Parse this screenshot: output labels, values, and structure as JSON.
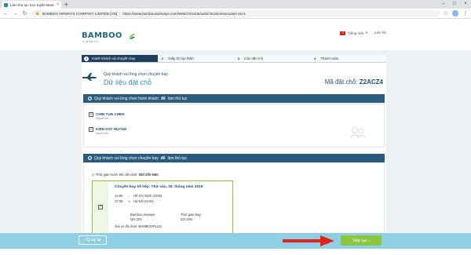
{
  "browser": {
    "tab_title": "Làm thủ tục trực tuyến Bamboo ...",
    "tab_close": "×",
    "new_tab": "+",
    "url_secure_label": "BAMBOO AIRWAYS COMPANY LIMITED [VN]",
    "url": "https://www.bamboosairways.com/Web/CheckIn/web/checkin/execution-s1c1",
    "window_controls": [
      "–",
      "□",
      "×"
    ]
  },
  "header": {
    "logo_text": "BAMBOO",
    "logo_sub": "AIRWAYS",
    "language": "Tiếng Việt",
    "contact": "Liên hệ"
  },
  "steps": [
    {
      "num": "1",
      "label": "Hành khách và chuyến bay",
      "active": true
    },
    {
      "num": "2",
      "label": "Giấy tờ tùy thân",
      "active": false
    },
    {
      "num": "3",
      "label": "Các tiện ích",
      "active": false
    },
    {
      "num": "4",
      "label": "Thanh toán",
      "active": false
    }
  ],
  "booking": {
    "subtitle": "Quý khách vui lòng chọn chuyến bay",
    "title": "Dữ liệu đặt chỗ",
    "pnr_label": "Mã đặt chỗ:",
    "pnr_code": "Z2ACZ4"
  },
  "passengers_section": {
    "title_pre": "Quý khách vui lòng chọn hành khách",
    "title_bold": "để",
    "title_post": "làm thủ tục",
    "passengers": [
      {
        "name": "CHIN YUN CHEN",
        "role": "Người lớn"
      },
      {
        "name": "KIEN DAT HUYNH",
        "role": "Người lớn"
      }
    ]
  },
  "flight_section": {
    "title_pre": "Quý khách vui lòng chọn chuyến bay",
    "title_bold": "để",
    "title_post": "làm thủ tục",
    "time_left_label": "Thời gian trước khi cất cánh:",
    "time_left_value": "00d 23h 54m",
    "flight": {
      "title": "Chuyến bay kế tiếp: Thứ sáu, 05. tháng năm 2019",
      "dep_time": "14:55",
      "dep_place": "Hồ Chí Minh (SGN)",
      "arr_time": "17:05",
      "arr_place": "Hà Nội (HAN)",
      "airline": "Bamboo Airways",
      "flight_no": "QH-204",
      "duration_label": "Thời gian bay:",
      "duration": "02t 10m",
      "fare": "Giá vé đã chọn: BAMBOOPLUS"
    }
  },
  "footer": {
    "back_label": "‹ Quay lại",
    "next_label": "Tiếp tục ›"
  },
  "colors": {
    "brand_dark": "#1f3f5f",
    "brand_teal": "#1d6a82",
    "accent_green": "#8cc63f",
    "footer_blue": "#8fcfe6",
    "arrow_red": "#e2231a"
  }
}
